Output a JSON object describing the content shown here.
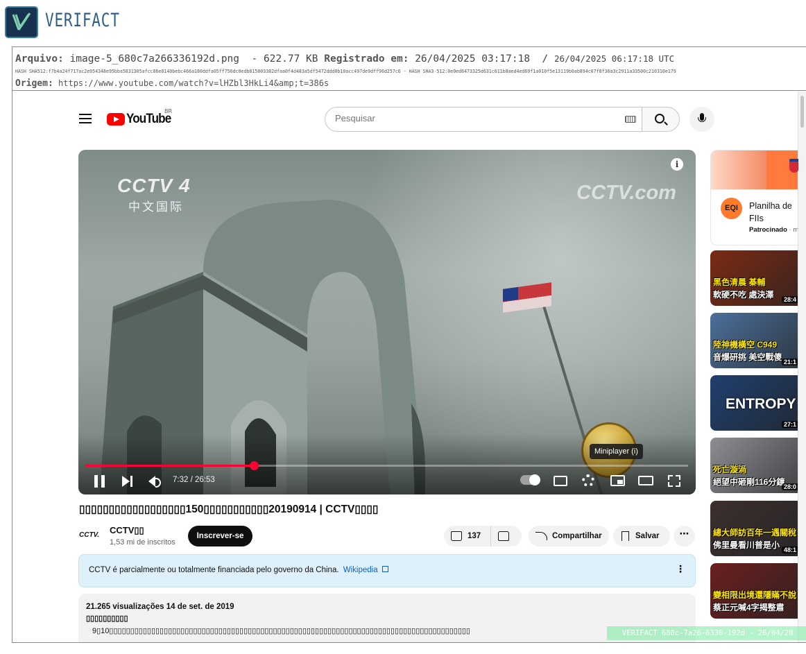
{
  "verifact": {
    "brand": "VERIFACT",
    "file_label": "Arquivo:",
    "file_name": "image-5_680c7a266336192d.png",
    "file_size": "- 622.77 KB",
    "registered_label": "Registrado em:",
    "registered_local": "26/04/2025 03:17:18",
    "separator": "/",
    "registered_utc": "26/04/2025 06:17:18 UTC",
    "hash_line": "HASH SHA512:f7b4a24f717ac2e954348e95bba5831305afcc86e8140bebc466a180ddfa05ff756dc0edb815003382dfaa0f4d483a5df5472ddd0b10acc497de9dff96d257c6   -   HASH SHA3-512:0e9ed6473325d631c611b8aed4ed69f1a010f5e13119b0ab894c07f8f36a3c2911a33500c210310e179",
    "origin_label": "Origem:",
    "origin_url": "https://www.youtube.com/watch?v=lHZbl3HkLi4&amp;t=386s",
    "watermark": "VERIFACT 680c-7a26-6336-192d - 26/04/20"
  },
  "youtube": {
    "logo_word": "YouTube",
    "country_code": "BR",
    "search_placeholder": "Pesquisar"
  },
  "player": {
    "overlay_cctv4": "CCTV 4",
    "overlay_cctv4_sub": "中文国际",
    "overlay_cctv_hd": "CCTV.com",
    "info": "i",
    "time": "7:32 / 26:53",
    "progress_fraction": 0.28,
    "tooltip": "Miniplayer (i)"
  },
  "video": {
    "title": "▯▯▯▯▯▯▯▯▯▯▯▯▯▯▯▯▯▯150▯▯▯▯▯▯▯▯▯▯▯20190914 | CCTV▯▯▯▯",
    "channel_logo": "CCTV.",
    "channel_name": "CCTV▯▯",
    "subscribers": "1,53 mi de inscritos",
    "subscribe_label": "Inscrever-se",
    "likes": "137",
    "share_label": "Compartilhar",
    "save_label": "Salvar",
    "more": "⋯"
  },
  "notice": {
    "text": "CCTV é parcialmente ou totalmente financiada pelo governo da China.",
    "link": "Wikipedia",
    "more": "⋮"
  },
  "description": {
    "stats": "21.265 visualizações  14 de set. de 2019",
    "line1": "▯▯▯▯▯▯▯▯▯▯",
    "line2": "9▯10▯▯▯▯▯▯▯▯▯▯▯▯▯▯▯▯▯▯▯▯▯▯▯▯▯▯▯▯▯▯▯▯▯▯▯▯▯▯▯▯▯▯▯▯▯▯▯▯▯▯▯▯▯▯▯▯▯▯▯▯▯▯▯▯▯▯▯▯▯▯▯▯▯▯▯▯▯▯▯▯▯▯▯▯▯▯"
  },
  "sidebar": {
    "ad": {
      "logo": "EQI",
      "title": "Planilha de FIIs",
      "sponsored": "Patrocinado",
      "sponsored_suffix": " · m"
    },
    "videos": [
      {
        "thumb_text": "黑色清晨 棊輔",
        "thumb_text2": "軟硬不吃 處決澤",
        "duration": "28:4",
        "bg": "#7b2a14"
      },
      {
        "thumb_text": "陸神機橫空 C949",
        "thumb_text2": "音爆研挑 美空戰傻",
        "duration": "21:1",
        "bg": "#4b6f9a"
      },
      {
        "thumb_text": "ENTROPY",
        "duration": "27:1",
        "bg": "#1f3f6e"
      },
      {
        "thumb_text": "死亡漩渦",
        "thumb_text2": "絕望中砸剛116分鐘",
        "duration": "28:0",
        "bg": "#8d8f95"
      },
      {
        "thumb_text": "總大師訪百年一遇關稅",
        "thumb_text2": "佛里曼看川普是小",
        "duration": "48:1",
        "bg": "#3c2f2f"
      },
      {
        "thumb_text": "變相限出境還隱瞞不說",
        "thumb_text2": "蔡正元喊4字揭整肅",
        "duration": "",
        "bg": "#6a1f1f"
      }
    ]
  }
}
